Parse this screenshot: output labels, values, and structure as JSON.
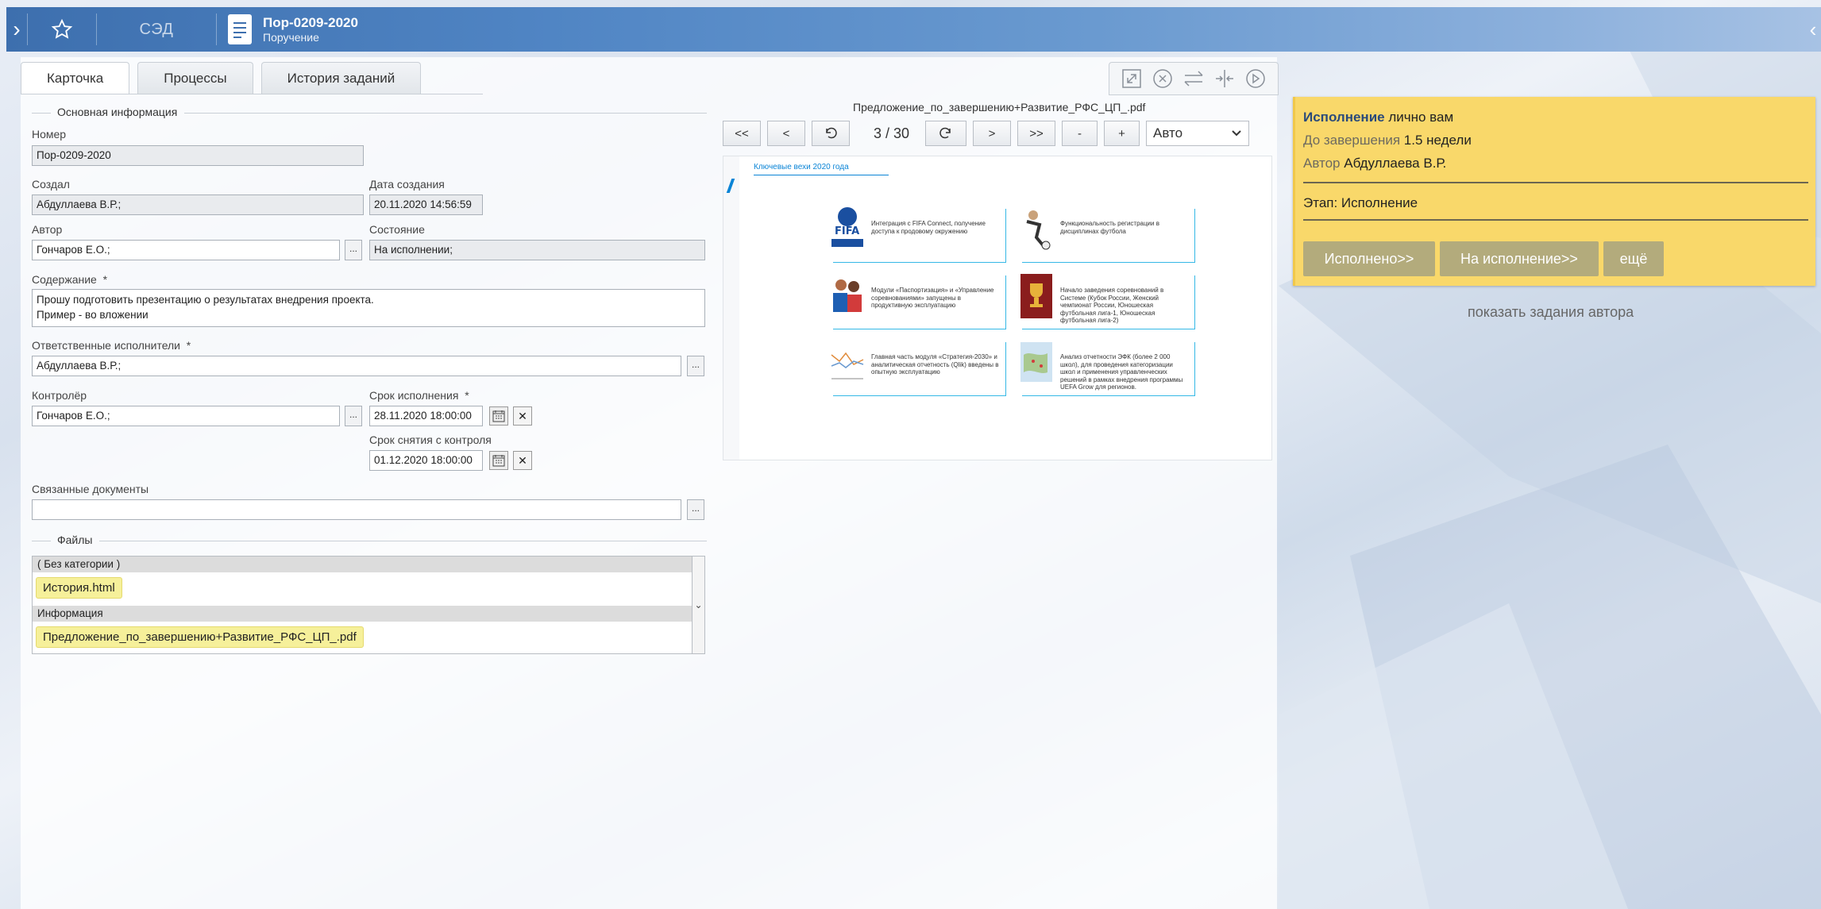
{
  "topbar": {
    "app_name": "СЭД",
    "doc_title": "Пор-0209-2020",
    "doc_subtitle": "Поручение"
  },
  "tabs": [
    {
      "label": "Карточка",
      "active": true
    },
    {
      "label": "Процессы",
      "active": false
    },
    {
      "label": "История заданий",
      "active": false
    }
  ],
  "form": {
    "section_main": "Основная информация",
    "number_label": "Номер",
    "number_value": "Пор-0209-2020",
    "created_label": "Создал",
    "created_value": "Абдуллаева В.Р.;",
    "created_date_label": "Дата создания",
    "created_date_value": "20.11.2020 14:56:59",
    "author_label": "Автор",
    "author_value": "Гончаров Е.О.;",
    "state_label": "Состояние",
    "state_value": "На исполнении;",
    "content_label": "Содержание",
    "content_line1": "Прошу подготовить презентацию о результатах внедрения проекта.",
    "content_line2": "Пример - во вложении",
    "responsible_label": "Ответственные исполнители",
    "responsible_value": "Абдуллаева В.Р.;",
    "controller_label": "Контролёр",
    "controller_value": "Гончаров Е.О.;",
    "deadline_label": "Срок исполнения",
    "deadline_value": "28.11.2020 18:00:00",
    "control_removal_label": "Срок снятия с контроля",
    "control_removal_value": "01.12.2020 18:00:00",
    "related_docs_label": "Связанные документы",
    "related_docs_value": "",
    "required_mark": "*",
    "dots": "...",
    "section_files": "Файлы"
  },
  "files": [
    {
      "category": "( Без категории )",
      "file": "История.html"
    },
    {
      "category": "Информация",
      "file": "Предложение_по_завершению+Развитие_РФС_ЦП_.pdf"
    }
  ],
  "viewer": {
    "filename": "Предложение_по_завершению+Развитие_РФС_ЦП_.pdf",
    "btn_first": "<<",
    "btn_prev": "<",
    "btn_next": ">",
    "btn_last": ">>",
    "btn_zoom_out": "-",
    "btn_zoom_in": "+",
    "page_counter": "3 / 30",
    "zoom_value": "Авто",
    "page": {
      "heading": "Ключевые вехи 2020 года",
      "cards": [
        "Интеграция с FIFA Connect, получение доступа к продовому окружению",
        "Функциональность регистрации в дисциплинах футбола",
        "Модули «Паспортизация» и «Управление соревнованиями» запущены в продуктивную эксплуатацию",
        "Начало заведения соревнований в Системе (Кубок России, Женский чемпионат России, Юношеская футбольная лига-1, Юношеская футбольная лига-2)",
        "Главная часть модуля «Стратегия-2030» и аналитическая отчетность (Qlik) введены в опытную эксплуатацию",
        "Анализ отчетности ЭФК (более 2 000 школ), для проведения категоризации школ и применения управленческих решений в рамках внедрения программы UEFA Grow для регионов."
      ]
    }
  },
  "task": {
    "title_bold": "Исполнение",
    "title_rest": " лично вам",
    "due_label": "До завершения",
    "due_value": " 1.5 недели",
    "author_label": "Автор",
    "author_value": " Абдуллаева В.Р.",
    "stage": "Этап: Исполнение",
    "btn_done": "Исполнено>>",
    "btn_exec": "На исполнение>>",
    "btn_more": "ещё",
    "show_author_tasks": "показать задания автора"
  },
  "colors": {
    "topbar": "#3d6fae",
    "task_card": "#f9d86a",
    "task_button": "#b3ab7c",
    "file_chip": "#f6f09a",
    "pdf_accent": "#0a84d6"
  }
}
